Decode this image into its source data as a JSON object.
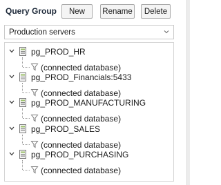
{
  "panel": {
    "title": "Query Group",
    "buttons": {
      "new": "New",
      "rename": "Rename",
      "delete": "Delete"
    }
  },
  "group_select": {
    "selected": "Production servers"
  },
  "tree": {
    "nodes": [
      {
        "label": "pg_PROD_HR",
        "expanded": true,
        "child": "(connected database)"
      },
      {
        "label": "pg_PROD_Financials:5433",
        "expanded": true,
        "child": "(connected database)"
      },
      {
        "label": "pg_PROD_MANUFACTURING",
        "expanded": true,
        "child": "(connected database)"
      },
      {
        "label": "pg_PROD_SALES",
        "expanded": true,
        "child": "(connected database)"
      },
      {
        "label": "pg_PROD_PURCHASING",
        "expanded": true,
        "child": "(connected database)"
      }
    ]
  },
  "icons": {
    "expand_toggle": "chevron-down-icon",
    "server": "database-icon",
    "filter": "filter-icon",
    "dropdown": "chevron-down-icon"
  }
}
